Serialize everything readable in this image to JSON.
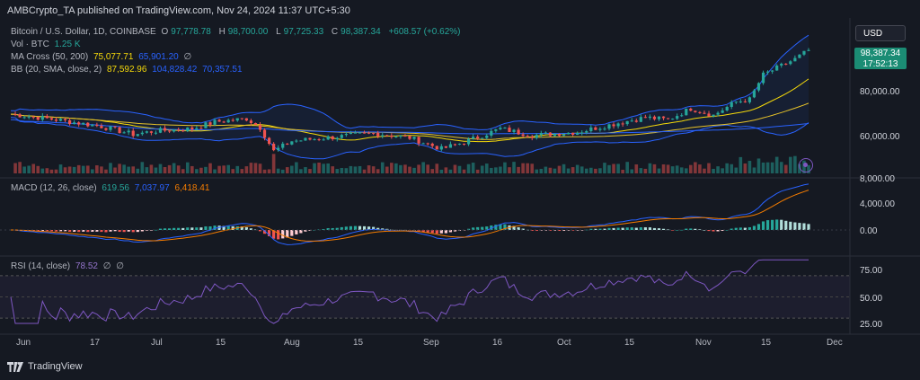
{
  "header": {
    "publisher": "AMBCrypto_TA published on TradingView.com, Nov 24, 2024 11:37 UTC+5:30"
  },
  "symbol": {
    "name": "Bitcoin / U.S. Dollar, 1D, COINBASE",
    "o_label": "O",
    "o": "97,778.78",
    "h_label": "H",
    "h": "98,700.00",
    "l_label": "L",
    "l": "97,725.33",
    "c_label": "C",
    "c": "98,387.34",
    "chg": "+608.57 (+0.62%)"
  },
  "volume": {
    "label": "Vol · BTC",
    "value": "1.25 K"
  },
  "ma": {
    "label": "MA Cross (50, 200)",
    "v1": "75,077.71",
    "v2": "65,901.20",
    "end": "∅"
  },
  "bb": {
    "label": "BB (20, SMA, close, 2)",
    "v1": "87,592.96",
    "v2": "104,828.42",
    "v3": "70,357.51"
  },
  "macd": {
    "label": "MACD (12, 26, close)",
    "v1": "619.56",
    "v2": "7,037.97",
    "v3": "6,418.41"
  },
  "rsi": {
    "label": "RSI (14, close)",
    "v1": "78.52",
    "e1": "∅",
    "e2": "∅"
  },
  "currency": "USD",
  "price_tag": {
    "price": "98,387.34",
    "countdown": "17:52:13"
  },
  "price_axis": [
    "80,000.00",
    "60,000.00"
  ],
  "macd_axis": [
    "8,000.00",
    "4,000.00",
    "0.00"
  ],
  "rsi_axis": [
    "75.00",
    "50.00",
    "25.00"
  ],
  "x_axis": [
    "Jun",
    "17",
    "Jul",
    "15",
    "Aug",
    "15",
    "Sep",
    "16",
    "Oct",
    "15",
    "Nov",
    "15",
    "Dec"
  ],
  "footer": {
    "brand": "TradingView"
  },
  "colors": {
    "up": "#26a69a",
    "down": "#ef5350",
    "bb": "#2962ff",
    "ma_short": "#f5d90a",
    "ma_long": "#2962ff",
    "rsi": "#7e57c2"
  }
}
